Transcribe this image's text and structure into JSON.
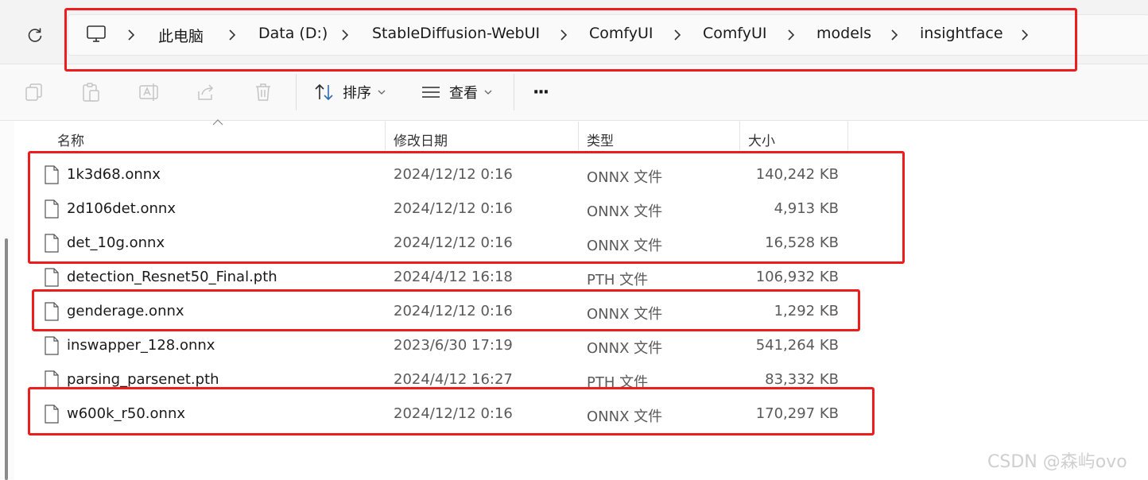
{
  "breadcrumb": {
    "icon": "computer-icon",
    "items": [
      "此电脑",
      "Data (D:)",
      "StableDiffusion-WebUI",
      "ComfyUI",
      "ComfyUI",
      "models",
      "insightface"
    ]
  },
  "toolbar": {
    "sort_label": "排序",
    "view_label": "查看",
    "more_label": "···"
  },
  "columns": {
    "name": "名称",
    "date": "修改日期",
    "type": "类型",
    "size": "大小"
  },
  "files": [
    {
      "name": "1k3d68.onnx",
      "date": "2024/12/12 0:16",
      "type": "ONNX 文件",
      "size": "140,242 KB"
    },
    {
      "name": "2d106det.onnx",
      "date": "2024/12/12 0:16",
      "type": "ONNX 文件",
      "size": "4,913 KB"
    },
    {
      "name": "det_10g.onnx",
      "date": "2024/12/12 0:16",
      "type": "ONNX 文件",
      "size": "16,528 KB"
    },
    {
      "name": "detection_Resnet50_Final.pth",
      "date": "2024/4/12 16:18",
      "type": "PTH 文件",
      "size": "106,932 KB"
    },
    {
      "name": "genderage.onnx",
      "date": "2024/12/12 0:16",
      "type": "ONNX 文件",
      "size": "1,292 KB"
    },
    {
      "name": "inswapper_128.onnx",
      "date": "2023/6/30 17:19",
      "type": "ONNX 文件",
      "size": "541,264 KB"
    },
    {
      "name": "parsing_parsenet.pth",
      "date": "2024/4/12 16:27",
      "type": "PTH 文件",
      "size": "83,332 KB"
    },
    {
      "name": "w600k_r50.onnx",
      "date": "2024/12/12 0:16",
      "type": "ONNX 文件",
      "size": "170,297 KB"
    }
  ],
  "watermark": "CSDN @森屿ovo",
  "colors": {
    "highlight_border": "#ee1d1d",
    "accent": "#2b6cb0"
  }
}
